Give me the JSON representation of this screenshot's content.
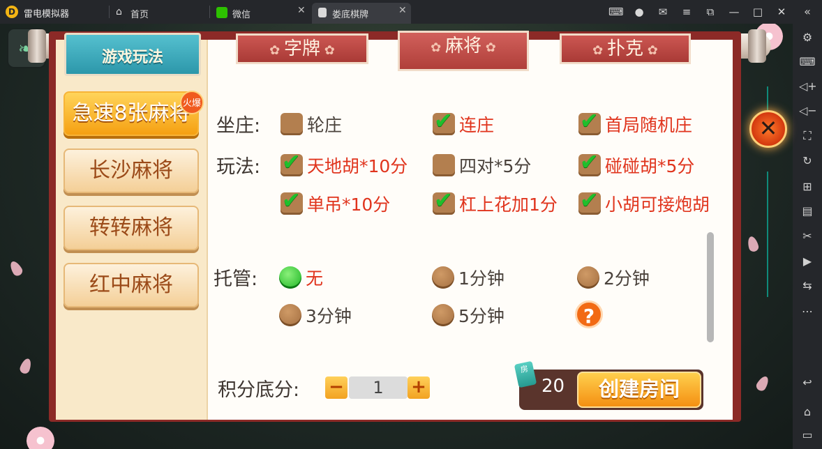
{
  "emulator": {
    "app_name": "雷电模拟器",
    "tabs": [
      {
        "label": "首页"
      },
      {
        "label": "微信"
      },
      {
        "label": "娄底棋牌"
      }
    ]
  },
  "game": {
    "rules_tab": "游戏玩法",
    "categories": [
      "字牌",
      "麻将",
      "扑克"
    ],
    "active_category": "麻将",
    "game_list": [
      "急速8张麻将",
      "长沙麻将",
      "转转麻将",
      "红中麻将"
    ],
    "hot_badge": "火爆",
    "rows": {
      "zuozhuang": {
        "label": "坐庄:",
        "options": [
          {
            "label": "轮庄",
            "checked": false
          },
          {
            "label": "连庄",
            "checked": true
          },
          {
            "label": "首局随机庄",
            "checked": true
          }
        ]
      },
      "wanfa": {
        "label": "玩法:",
        "options": [
          {
            "label": "天地胡*10分",
            "checked": true
          },
          {
            "label": "四对*5分",
            "checked": false
          },
          {
            "label": "碰碰胡*5分",
            "checked": true
          },
          {
            "label": "单吊*10分",
            "checked": true
          },
          {
            "label": "杠上花加1分",
            "checked": true
          },
          {
            "label": "小胡可接炮胡",
            "checked": true
          }
        ]
      },
      "tuoguan": {
        "label": "托管:",
        "options": [
          {
            "label": "无",
            "selected": true
          },
          {
            "label": "1分钟",
            "selected": false
          },
          {
            "label": "2分钟",
            "selected": false
          },
          {
            "label": "3分钟",
            "selected": false
          },
          {
            "label": "5分钟",
            "selected": false
          }
        ],
        "help": "?"
      }
    },
    "score": {
      "label": "积分底分:",
      "minus": "−",
      "plus": "+",
      "value": "1"
    },
    "room": {
      "card_icon": "房",
      "cost": "20",
      "create_label": "创建房间"
    },
    "close": "✕"
  }
}
